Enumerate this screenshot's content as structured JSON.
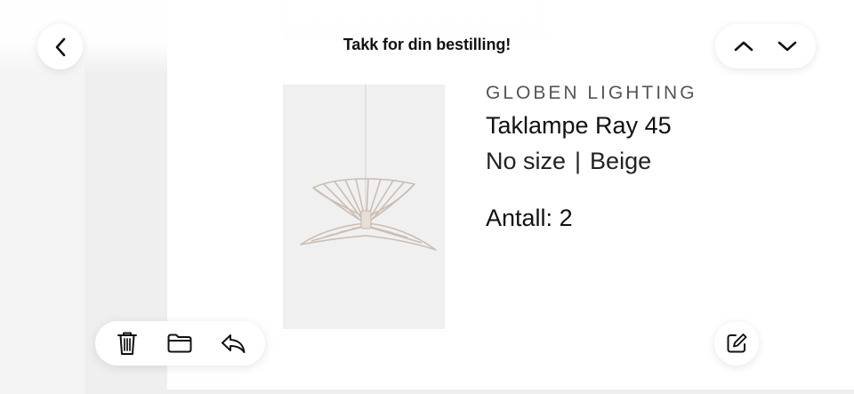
{
  "nav": {
    "title": "Takk for din bestilling!"
  },
  "product": {
    "brand": "GLOBEN LIGHTING",
    "name": "Taklampe Ray 45",
    "size": "No size",
    "separator": "|",
    "color": "Beige",
    "quantity_label": "Antall:",
    "quantity_value": "2"
  },
  "icons": {
    "back": "chevron-left-icon",
    "previous": "chevron-up-icon",
    "next": "chevron-down-icon",
    "delete": "trash-icon",
    "move": "folder-icon",
    "reply": "reply-icon",
    "compose": "compose-icon"
  },
  "colors": {
    "background": "#f4f4f5",
    "card": "#ffffff",
    "text": "#111111",
    "image_bg": "#f0f0f0",
    "lamp": "#cdbfb4"
  }
}
